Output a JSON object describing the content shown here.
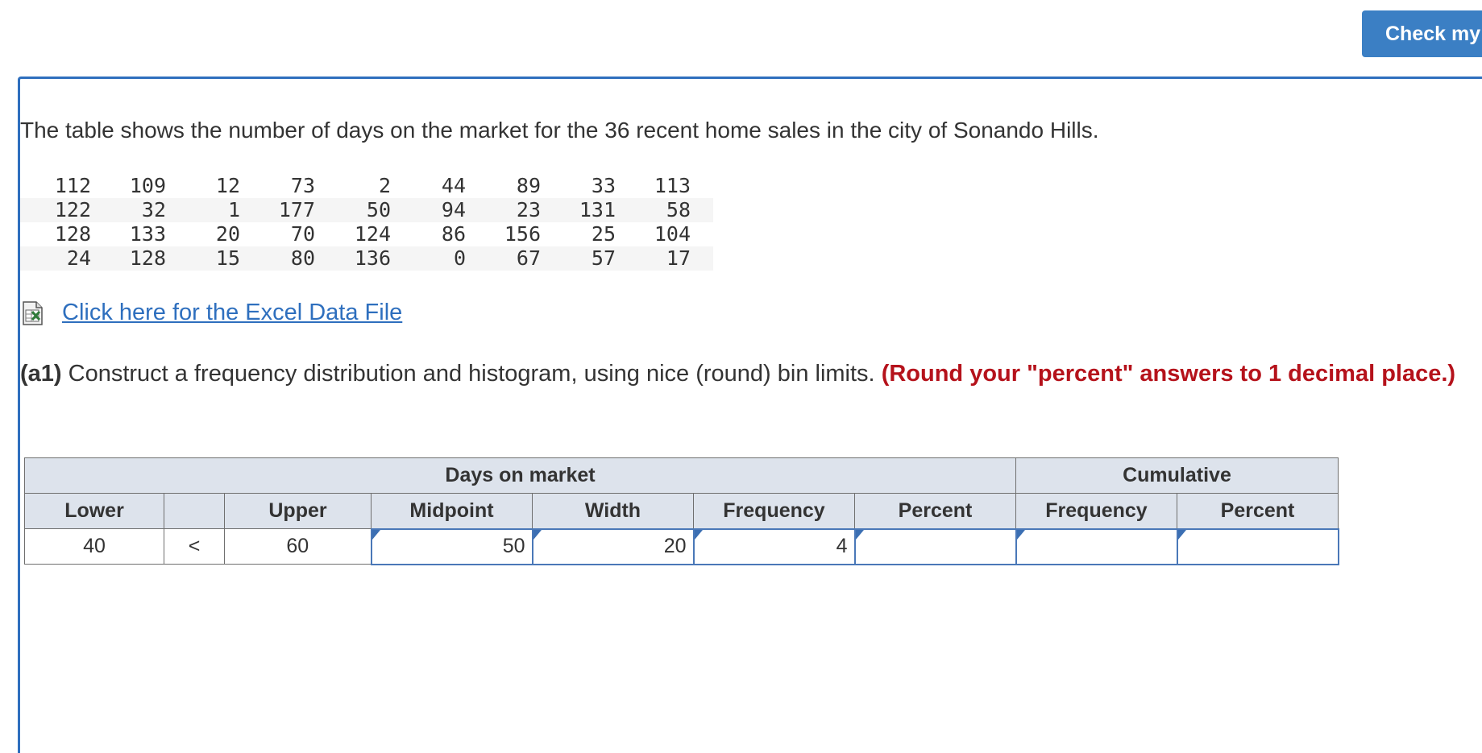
{
  "header": {
    "check_button_label": "Check my"
  },
  "intro_text": "The table shows the number of days on the market for the 36 recent home sales in the city of Sonando Hills.",
  "data_rows": [
    [
      "112",
      "109",
      "12",
      "73",
      "2",
      "44",
      "89",
      "33",
      "113"
    ],
    [
      "122",
      "32",
      "1",
      "177",
      "50",
      "94",
      "23",
      "131",
      "58"
    ],
    [
      "128",
      "133",
      "20",
      "70",
      "124",
      "86",
      "156",
      "25",
      "104"
    ],
    [
      "24",
      "128",
      "15",
      "80",
      "136",
      "0",
      "67",
      "57",
      "17"
    ]
  ],
  "excel_link_label": "Click here for the Excel Data File",
  "question": {
    "label": "(a1)",
    "text": " Construct a frequency distribution and histogram, using nice (round) bin limits. ",
    "note": "(Round your \"percent\" answers to 1 decimal place.)"
  },
  "table": {
    "group_headers": {
      "days_on_market": "Days on market",
      "cumulative": "Cumulative"
    },
    "columns": [
      "Lower",
      "",
      "Upper",
      "Midpoint",
      "Width",
      "Frequency",
      "Percent",
      "Frequency",
      "Percent"
    ],
    "row": {
      "lower": "40",
      "op": "<",
      "upper": "60",
      "midpoint": "50",
      "width": "20",
      "frequency": "4",
      "percent": "",
      "cum_frequency": "",
      "cum_percent": ""
    }
  }
}
